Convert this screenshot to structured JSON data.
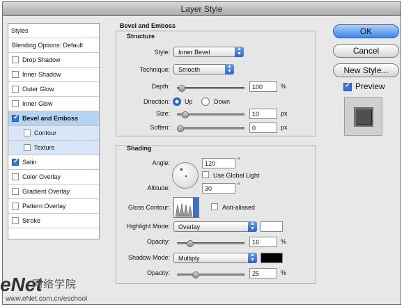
{
  "window": {
    "title": "Layer Style"
  },
  "sidebar": {
    "header": "Styles",
    "items": [
      {
        "label": "Blending Options: Default",
        "checkbox": false,
        "checked": false,
        "bold": false,
        "selected": false
      },
      {
        "label": "Drop Shadow",
        "checkbox": true,
        "checked": false,
        "bold": false,
        "selected": false
      },
      {
        "label": "Inner Shadow",
        "checkbox": true,
        "checked": false,
        "bold": false,
        "selected": false
      },
      {
        "label": "Outer Glow",
        "checkbox": true,
        "checked": false,
        "bold": false,
        "selected": false
      },
      {
        "label": "Inner Glow",
        "checkbox": true,
        "checked": false,
        "bold": false,
        "selected": false
      },
      {
        "label": "Bevel and Emboss",
        "checkbox": true,
        "checked": true,
        "bold": true,
        "selected": true
      },
      {
        "label": "Contour",
        "checkbox": true,
        "checked": false,
        "bold": false,
        "selected": false,
        "sub": true
      },
      {
        "label": "Texture",
        "checkbox": true,
        "checked": false,
        "bold": false,
        "selected": false,
        "sub": true
      },
      {
        "label": "Satin",
        "checkbox": true,
        "checked": true,
        "bold": false,
        "selected": false
      },
      {
        "label": "Color Overlay",
        "checkbox": true,
        "checked": false,
        "bold": false,
        "selected": false
      },
      {
        "label": "Gradient Overlay",
        "checkbox": true,
        "checked": false,
        "bold": false,
        "selected": false
      },
      {
        "label": "Pattern Overlay",
        "checkbox": true,
        "checked": false,
        "bold": false,
        "selected": false
      },
      {
        "label": "Stroke",
        "checkbox": true,
        "checked": false,
        "bold": false,
        "selected": false
      }
    ]
  },
  "main": {
    "title": "Bevel and Emboss",
    "structure": {
      "heading": "Structure",
      "style_label": "Style:",
      "style_value": "Inner Bevel",
      "technique_label": "Technique:",
      "technique_value": "Smooth",
      "depth_label": "Depth:",
      "depth_value": "100",
      "depth_unit": "%",
      "depth_slider": 0.02,
      "direction_label": "Direction:",
      "direction_up": "Up",
      "direction_down": "Down",
      "direction_selected": "Up",
      "size_label": "Size:",
      "size_value": "10",
      "size_unit": "px",
      "size_slider": 0.08,
      "soften_label": "Soften:",
      "soften_value": "0",
      "soften_unit": "px",
      "soften_slider": 0.0
    },
    "shading": {
      "heading": "Shading",
      "angle_label": "Angle:",
      "angle_value": "120",
      "angle_unit": "°",
      "use_global_light": "Use Global Light",
      "use_global_light_checked": false,
      "altitude_label": "Altitude:",
      "altitude_value": "30",
      "altitude_unit": "°",
      "gloss_contour_label": "Gloss Contour:",
      "anti_aliased": "Anti-aliased",
      "anti_aliased_checked": false,
      "highlight_mode_label": "Highlight Mode:",
      "highlight_mode_value": "Overlay",
      "highlight_color": "#ffffff",
      "highlight_opacity_label": "Opacity:",
      "highlight_opacity_value": "16",
      "highlight_opacity_unit": "%",
      "highlight_opacity_slider": 0.16,
      "shadow_mode_label": "Shadow Mode:",
      "shadow_mode_value": "Multiply",
      "shadow_color": "#000000",
      "shadow_opacity_label": "Opacity:",
      "shadow_opacity_value": "25",
      "shadow_opacity_unit": "%",
      "shadow_opacity_slider": 0.25
    }
  },
  "buttons": {
    "ok": "OK",
    "cancel": "Cancel",
    "new_style": "New Style...",
    "preview": "Preview",
    "preview_checked": true
  },
  "watermark": {
    "logo": "eNet",
    "cn": "网络学院",
    "url": "www.eNet.com.cn/eschool"
  }
}
